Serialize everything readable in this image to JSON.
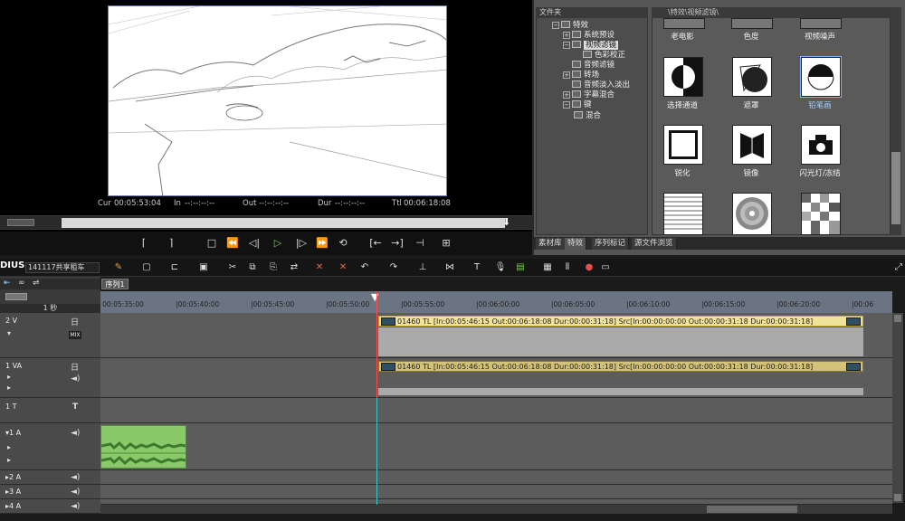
{
  "player": {
    "timecodes": [
      {
        "label": "Cur",
        "value": "00:05:53:04"
      },
      {
        "label": "In",
        "value": "--:--:--:--"
      },
      {
        "label": "Out",
        "value": "--:--:--:--"
      },
      {
        "label": "Dur",
        "value": "--:--:--:--"
      },
      {
        "label": "Ttl",
        "value": "00:06:18:08"
      }
    ]
  },
  "effects": {
    "tree_header": "文件夹",
    "gallery_header": "\\特效\\视频滤镜\\",
    "tree": [
      {
        "label": "特效",
        "expander": "−"
      },
      {
        "label": "系统预设",
        "expander": "+"
      },
      {
        "label": "视频滤镜",
        "expander": "−",
        "selected": true
      },
      {
        "label": "色彩校正",
        "expander": ""
      },
      {
        "label": "音频滤镜",
        "expander": ""
      },
      {
        "label": "转场",
        "expander": "+"
      },
      {
        "label": "音频淡入淡出",
        "expander": ""
      },
      {
        "label": "字幕混合",
        "expander": "+"
      },
      {
        "label": "键",
        "expander": "−"
      },
      {
        "label": "混合",
        "expander": ""
      }
    ],
    "tiles": [
      {
        "label": "老电影",
        "icon": "old-film-icon"
      },
      {
        "label": "色度",
        "icon": "chroma-icon"
      },
      {
        "label": "视频噪声",
        "icon": "video-noise-icon"
      },
      {
        "label": "选择通道",
        "icon": "select-channel-icon"
      },
      {
        "label": "遮罩",
        "icon": "mask-icon"
      },
      {
        "label": "铅笔画",
        "icon": "pencil-sketch-icon",
        "selected": true
      },
      {
        "label": "锐化",
        "icon": "sharpen-icon"
      },
      {
        "label": "镜像",
        "icon": "mirror-icon"
      },
      {
        "label": "闪光灯/冻结",
        "icon": "strobe-freeze-icon"
      },
      {
        "label": "",
        "icon": "lines-icon"
      },
      {
        "label": "",
        "icon": "radial-icon"
      },
      {
        "label": "",
        "icon": "mosaic-icon"
      }
    ],
    "tabs": [
      "素材库",
      "特效",
      "序列标记",
      "源文件浏览"
    ]
  },
  "timeline": {
    "app_title": "DIUS",
    "project_name": "141117共享租车",
    "sequence_tab": "序列1",
    "zoom_label": "1 秒",
    "ruler_ticks": [
      "00:05:35:00",
      "|00:05:40:00",
      "|00:05:45:00",
      "|00:05:50:00",
      "|00:05:55:00",
      "|00:06:00:00",
      "|00:06:05:00",
      "|00:06:10:00",
      "|00:06:15:00",
      "|00:06:20:00",
      "|00:06"
    ],
    "tracks": [
      {
        "label": "2 V"
      },
      {
        "label": "1 VA"
      },
      {
        "label": "1 T"
      },
      {
        "label": "▾1 A"
      },
      {
        "label": "▸2 A"
      },
      {
        "label": "▸3 A"
      },
      {
        "label": "▸4 A"
      }
    ],
    "clip_text": "01460  TL [In:00:05:46:15 Out:00:06:18:08 Dur:00:00:31:18]  Src[In:00:00:00:00 Out:00:00:31:18 Dur:00:00:31:18]",
    "mix_badge": "MIX"
  }
}
